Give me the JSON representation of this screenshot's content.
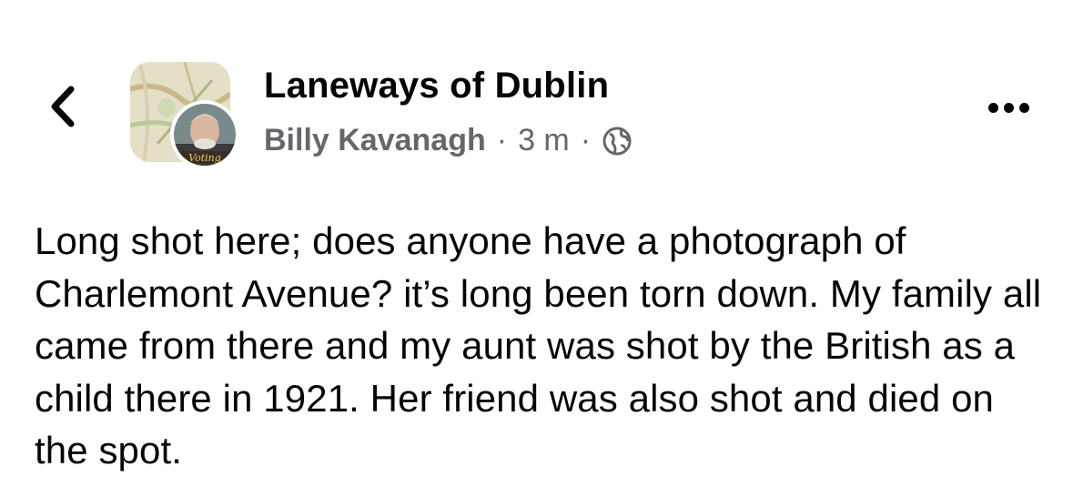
{
  "header": {
    "back_icon": "chevron-left-icon",
    "group_name": "Laneways of Dublin",
    "author_name": "Billy Kavanagh",
    "separator": "·",
    "time_ago": "3 m",
    "privacy_icon": "globe-icon",
    "avatar_badge_text": "Voting",
    "more_icon": "more-horizontal-icon"
  },
  "post": {
    "text": "Long shot here; does anyone have a photograph of Charlemont Avenue? it’s long been torn down. My family all came from there and my aunt was shot by the British as a child there in 1921. Her friend was also shot and died on the spot."
  },
  "colors": {
    "primary_text": "#050505",
    "secondary_text": "#65676b",
    "background": "#ffffff"
  }
}
